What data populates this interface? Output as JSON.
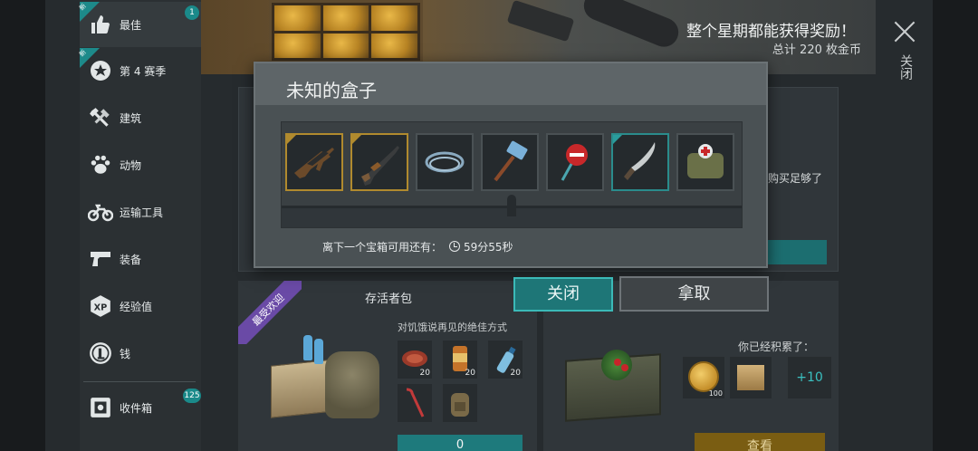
{
  "sidebar": {
    "items": [
      {
        "label": "最佳",
        "icon": "thumbs-up-icon",
        "badge": "1",
        "new": true
      },
      {
        "label": "第 4 赛季",
        "icon": "season-star-icon",
        "new": true
      },
      {
        "label": "建筑",
        "icon": "tools-icon"
      },
      {
        "label": "动物",
        "icon": "paw-icon"
      },
      {
        "label": "运输工具",
        "icon": "motorbike-icon"
      },
      {
        "label": "装备",
        "icon": "pistol-icon"
      },
      {
        "label": "经验值",
        "icon": "xp-icon"
      },
      {
        "label": "钱",
        "icon": "coin-icon"
      },
      {
        "label": "收件箱",
        "icon": "inbox-icon",
        "badge": "125"
      }
    ],
    "new_tag": "新"
  },
  "banner": {
    "title": "整个星期都能获得奖励！",
    "subtitle": "总计 220 枚金币"
  },
  "window_close": {
    "label": "关闭"
  },
  "modal": {
    "title": "未知的盒子",
    "items": [
      {
        "icon": "assault-rifle-icon",
        "rarity": "gold"
      },
      {
        "icon": "shotgun-icon",
        "rarity": "gold"
      },
      {
        "icon": "rope-icon",
        "rarity": "none"
      },
      {
        "icon": "sledgehammer-icon",
        "rarity": "none"
      },
      {
        "icon": "stop-sign-icon",
        "rarity": "none"
      },
      {
        "icon": "machete-icon",
        "rarity": "teal"
      },
      {
        "icon": "medkit-bag-icon",
        "rarity": "none"
      }
    ],
    "timer_label": "离下一个宝箱可用还有：",
    "timer_value": "59分55秒"
  },
  "buttons": {
    "close": "关闭",
    "take": "拿取"
  },
  "background": {
    "side_text": "购买足够了",
    "pack": {
      "ribbon": "最受欢迎",
      "title": "存活者包",
      "subtitle": "对饥饿说再见的绝佳方式",
      "cells": [
        {
          "icon": "meat-icon",
          "count": "20"
        },
        {
          "icon": "canned-food-icon",
          "count": "20"
        },
        {
          "icon": "water-bottle-icon",
          "count": "20"
        },
        {
          "icon": "crowbar-icon",
          "count": ""
        },
        {
          "icon": "backpack-icon",
          "count": ""
        }
      ],
      "button": "0"
    },
    "crate": {
      "accumulated": "你已经积累了：",
      "coin_count": "100",
      "plus": "+10",
      "button": "查看"
    }
  }
}
